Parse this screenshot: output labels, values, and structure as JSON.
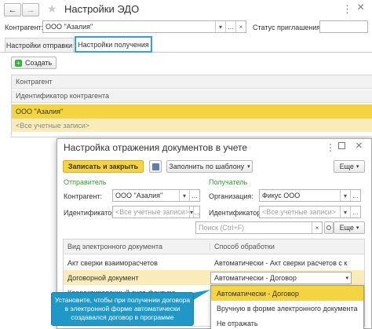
{
  "main": {
    "back_icon": "←",
    "forward_icon": "→",
    "star_icon": "★",
    "title": "Настройки ЭДО",
    "more_icon": "⋮",
    "close_icon": "×",
    "counterparty_label": "Контрагент:",
    "counterparty_value": "ООО \"Азалия\"",
    "invite_status_label": "Статус приглашения:",
    "tabs": [
      "Настройки отправки",
      "Настройки получения"
    ],
    "create_button": "Создать",
    "table_header_counterparty": "Контрагент",
    "table_header_id": "Идентификатор контрагента",
    "selected_row": "ООО \"Азалия\"",
    "selected_row_sub": "<Все учетные записи>"
  },
  "dialog": {
    "title": "Настройка отражения документов в учете",
    "save_close": "Записать и закрыть",
    "fill_template": "Заполнить по шаблону",
    "more": "Еще",
    "sender_section": "Отправитель",
    "receiver_section": "Получатель",
    "sender_counterparty_label": "Контрагент:",
    "sender_counterparty_value": "ООО \"Азалия\"",
    "sender_id_label": "Идентификатор:",
    "sender_id_placeholder": "<Все учетные записи>",
    "org_label": "Организация:",
    "org_value": "Фикус ООО",
    "receiver_id_label": "Идентификатор:",
    "receiver_id_placeholder": "<Все учетные записи>",
    "search_placeholder": "Поиск (Ctrl+F)",
    "more2": "Еще",
    "col_doc_type": "Вид электронного документа",
    "col_processing": "Способ обработки",
    "rows": [
      {
        "doc": "Акт сверки взаиморасчетов",
        "method": "Автоматически - Акт сверки расчетов с к"
      },
      {
        "doc": "Договорной документ",
        "method": "Автоматически - Договор"
      },
      {
        "doc": "Корректировочный счет-фактура",
        "method": ""
      }
    ],
    "dropdown_options": [
      "Автоматически - Договор",
      "Вручную в форме электронного документа",
      "Не отражать"
    ]
  },
  "callout": {
    "text_line1": "Установите, чтобы при получении договора",
    "text_line2": "в электронной форме автоматически",
    "text_line3": "создавался договор в программе"
  },
  "colors": {
    "accent_yellow": "#f5d442",
    "selected_row": "#f9ecb8",
    "callout_bg": "#1f97c7",
    "tab_active_border": "#3a9fd0"
  }
}
